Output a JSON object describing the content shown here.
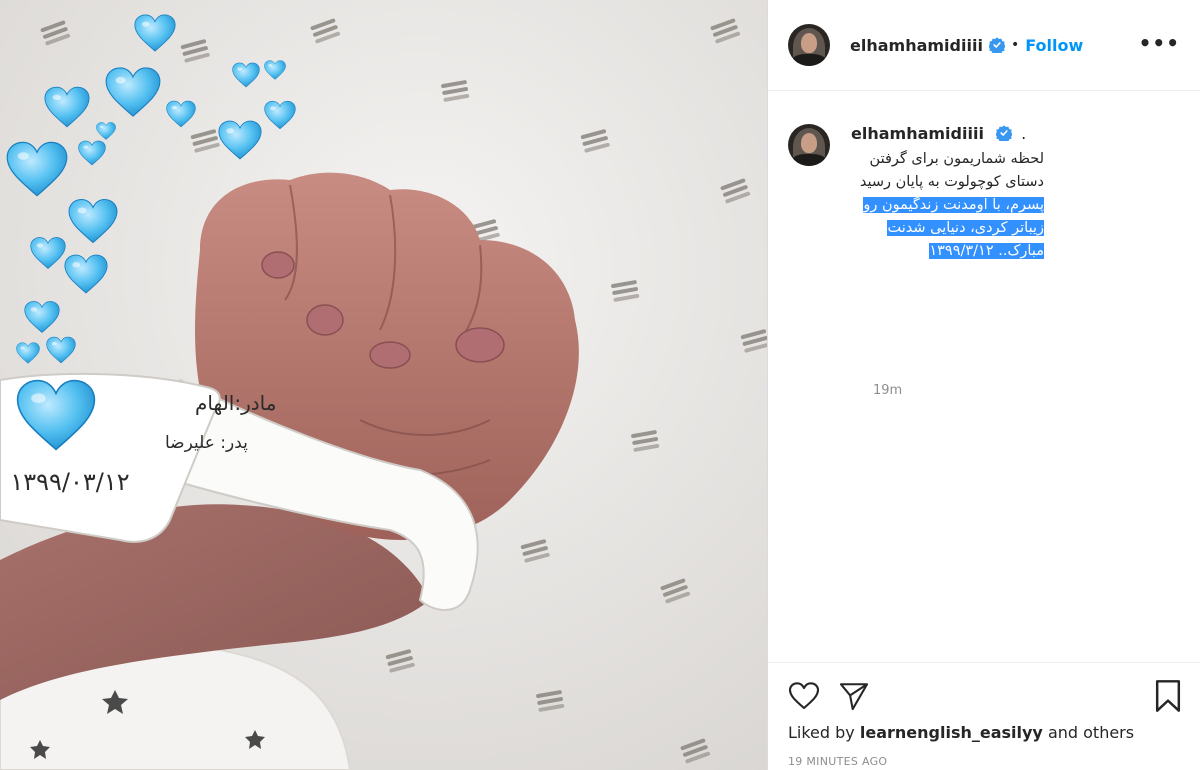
{
  "post": {
    "username": "elhamhamidiiii",
    "follow_label": "Follow",
    "separator": "•",
    "more_label": "•••"
  },
  "photo": {
    "wristband_line1": "مادر:الهام",
    "wristband_line2": "پدر: علیرضا",
    "wristband_date": "۱۳۹۹/۰۳/۱۲"
  },
  "comment": {
    "username": "elhamhamidiiii",
    "trailing": ".",
    "text_plain": "لحظه شماریمون برای گرفتن دستای کوچولوت به پایان رسید",
    "text_highlighted": "پسرم، با اومدنت زندگیمون رو زیباتر کردی، دنیایی شدنت مبارک.. ۱۳۹۹/۳/۱۲",
    "time": "19m"
  },
  "footer": {
    "liked_prefix": "Liked by ",
    "liked_user": "learnenglish_easilyy",
    "liked_suffix": " and others",
    "time_ago": "19 MINUTES AGO"
  },
  "icons": {
    "like": "heart-icon",
    "share": "paper-plane-icon",
    "save": "bookmark-icon",
    "verified": "verified-badge-icon",
    "more": "more-options-icon"
  },
  "colors": {
    "link_blue": "#0095f6",
    "verified_blue": "#3897f0",
    "highlight": "#3390ff",
    "heart_blue": "#4ab8ee",
    "muted": "#8e8e8e"
  }
}
